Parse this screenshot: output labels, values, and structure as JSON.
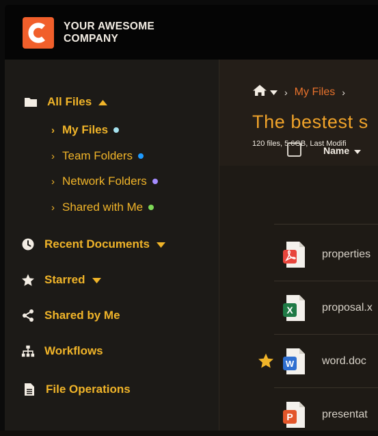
{
  "brand": {
    "line1": "YOUR AWESOME",
    "line2": "COMPANY",
    "logo_color": "#f15f2b"
  },
  "sidebar": {
    "all_files": "All Files",
    "sub_items": [
      {
        "label": "My Files",
        "dot_color": "#a6e3f0",
        "active": true
      },
      {
        "label": "Team Folders",
        "dot_color": "#1e9bff"
      },
      {
        "label": "Network Folders",
        "dot_color": "#a58cff"
      },
      {
        "label": "Shared with Me",
        "dot_color": "#7ed957"
      }
    ],
    "recent": "Recent Documents",
    "starred": "Starred",
    "shared_by_me": "Shared by Me",
    "workflows": "Workflows",
    "file_operations": "File Operations"
  },
  "main": {
    "breadcrumb": {
      "current": "My Files"
    },
    "title": "The bestest s",
    "meta": "120 files, 5.6GB, Last Modifi",
    "column_name": "Name",
    "files": [
      {
        "name": "properties",
        "icon": "pdf-icon",
        "color": "#e8453c",
        "starred": false
      },
      {
        "name": "proposal.x",
        "icon": "excel-icon",
        "color": "#1f7a45",
        "starred": false
      },
      {
        "name": "word.doc",
        "icon": "word-icon",
        "color": "#2f6fd0",
        "starred": true
      },
      {
        "name": "presentat",
        "icon": "powerpoint-icon",
        "color": "#e3562a",
        "starred": false
      }
    ]
  }
}
